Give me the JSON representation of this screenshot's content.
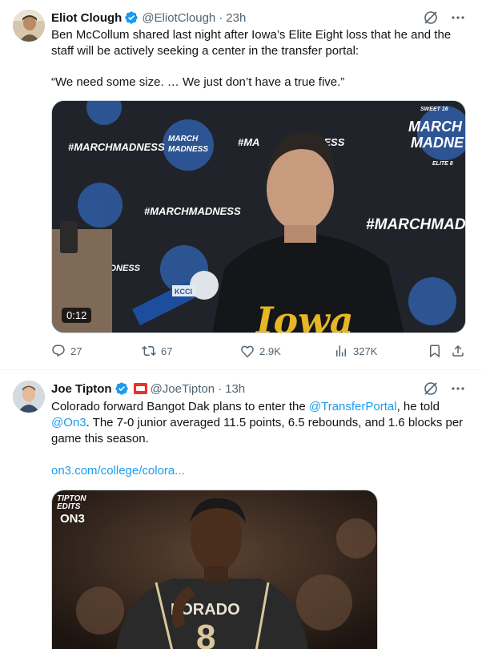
{
  "tweets": [
    {
      "name": "Eliot Clough",
      "handle": "@EliotClough",
      "dot": "·",
      "time": "23h",
      "text": "Ben McCollum shared last night after Iowa’s Elite Eight loss that he and the staff will be actively seeking a center in the transfer portal:",
      "quote": "“We need some size. … We just don’t have a true five.”",
      "media": {
        "video_time": "0:12",
        "backdrop_texts": [
          "#MARCHMADNESS",
          "#MARCHMADNESS",
          "#MA",
          "NESS",
          "#MARCHMAD",
          "MADNESS",
          "MARCH",
          "MADNESS",
          "SWEET 16",
          "ELITE 8",
          "MARCH",
          "MADNE"
        ],
        "shirt_text": "Iowa",
        "mic_flag": "KCCI"
      },
      "stats": {
        "replies": "27",
        "reposts": "67",
        "likes": "2.9K",
        "views": "327K"
      }
    },
    {
      "name": "Joe Tipton",
      "handle": "@JoeTipton",
      "dot": "·",
      "time": "13h",
      "text_parts": {
        "t1": "Colorado forward Bangot Dak plans to enter the ",
        "link1": "@TransferPortal",
        "t2": ", he told ",
        "link2": "@On3",
        "t3": ".   The 7-0 junior averaged 11.5 points, 6.5 rebounds, and 1.6 blocks per game this season."
      },
      "url": "on3.com/college/colora...",
      "media": {
        "edits_line1": "TIPTON",
        "edits_line2": "EDITS",
        "brand": "ON3",
        "jersey_text": "LORADO",
        "jersey_number": "8"
      }
    }
  ],
  "colors": {
    "accent": "#1d9bf0",
    "secondary_text": "#536471",
    "primary_text": "#0f1419"
  },
  "icons": [
    "verified-badge-icon",
    "grok-icon",
    "more-icon",
    "reply-icon",
    "repost-icon",
    "like-icon",
    "views-icon",
    "bookmark-icon",
    "share-icon"
  ]
}
